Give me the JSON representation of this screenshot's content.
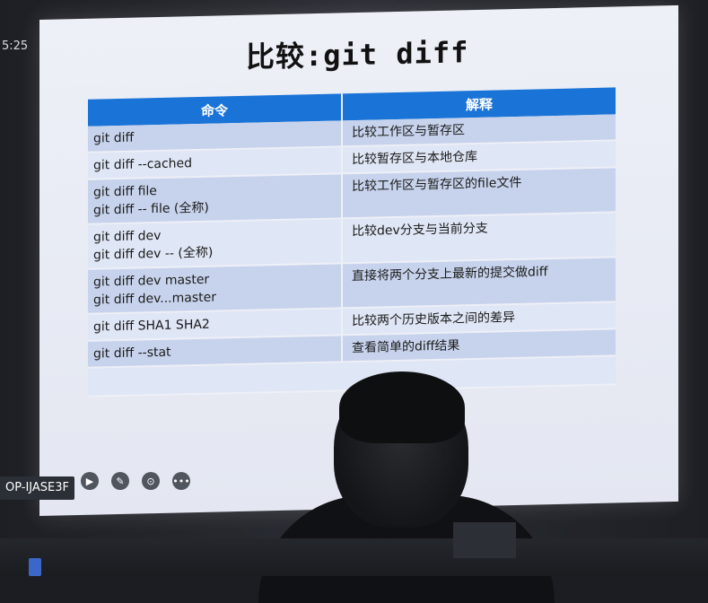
{
  "clock": "5:25",
  "slide": {
    "title": "比较:git diff",
    "table": {
      "headers": [
        "命令",
        "解释"
      ],
      "rows": [
        {
          "cmd": [
            "git diff"
          ],
          "desc": "比较工作区与暂存区"
        },
        {
          "cmd": [
            "git diff --cached"
          ],
          "desc": "比较暂存区与本地仓库"
        },
        {
          "cmd": [
            "git diff file",
            "git diff -- file (全称)"
          ],
          "desc": "比较工作区与暂存区的file文件"
        },
        {
          "cmd": [
            "git diff dev",
            "git diff dev -- (全称)"
          ],
          "desc": "比较dev分支与当前分支"
        },
        {
          "cmd": [
            "git diff dev master",
            "git diff dev...master"
          ],
          "desc": "直接将两个分支上最新的提交做diff"
        },
        {
          "cmd": [
            "git diff SHA1 SHA2"
          ],
          "desc": "比较两个历史版本之间的差异"
        },
        {
          "cmd": [
            "git diff --stat"
          ],
          "desc": "查看简单的diff结果"
        }
      ]
    }
  },
  "host_label": "OP-IJASE3F",
  "toolbar": {
    "icons": [
      "play-icon",
      "pencil-icon",
      "screenshot-icon",
      "more-icon"
    ],
    "glyphs": [
      "▶",
      "✎",
      "⊙",
      "•••"
    ]
  }
}
